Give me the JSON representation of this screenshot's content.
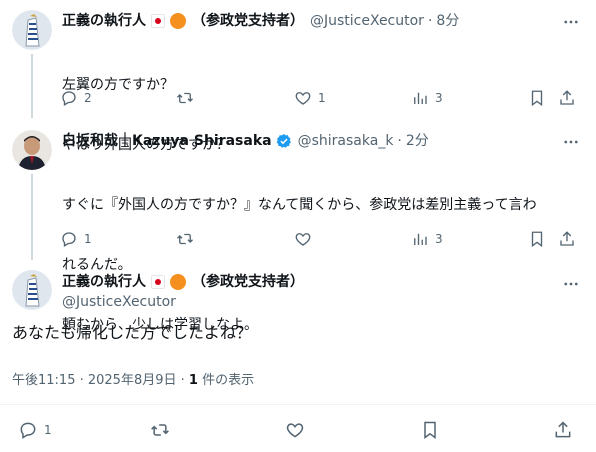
{
  "tweet1": {
    "name": "正義の執行人",
    "party": "（参政党支持者）",
    "handle": "@JusticeXecutor",
    "time": "8分",
    "lines": [
      "左翼の方ですか？",
      "やはり外国人の方ですか？"
    ],
    "actions": {
      "reply": "2",
      "retweet": "",
      "like": "1",
      "views": "3"
    }
  },
  "tweet2": {
    "name": "白坂和哉｜Kazuya Shirasaka",
    "handle": "@shirasaka_k",
    "time": "2分",
    "lines": [
      "すぐに『外国人の方ですか？』なんて聞くから、参政党は差別主義って言わ",
      "れるんだ。",
      "頼むから、少しは学習しなよ。"
    ],
    "actions": {
      "reply": "1",
      "retweet": "",
      "like": "",
      "views": "3"
    }
  },
  "main": {
    "name": "正義の執行人",
    "party": "（参政党支持者）",
    "handle": "@JusticeXecutor",
    "text": "あなたも帰化した方でしたよね？",
    "timestamp": "午後11:15 · 2025年8月9日 · ",
    "views_count": "1",
    "views_label": " 件の表示",
    "actions": {
      "reply": "1"
    }
  },
  "colors": {
    "text": "#0f1419",
    "meta": "#536471",
    "line": "#cfd9de",
    "verified": "#1d9bf0",
    "orange": "#f5901f",
    "flag_red": "#d9001b"
  },
  "icons": [
    "more-icon",
    "reply-icon",
    "retweet-icon",
    "like-icon",
    "views-icon",
    "bookmark-icon",
    "share-icon",
    "verified-icon"
  ]
}
